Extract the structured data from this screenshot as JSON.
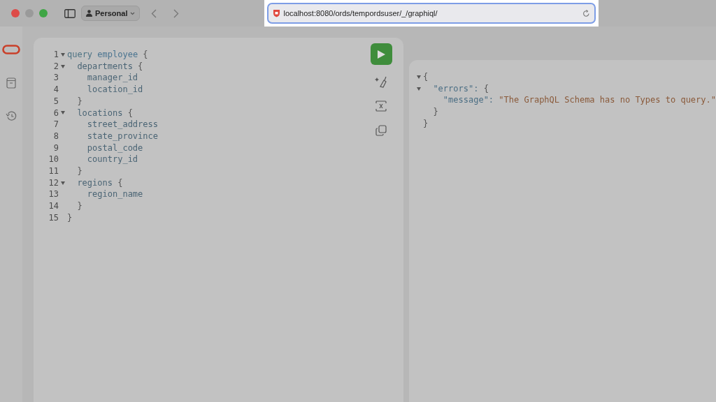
{
  "browser": {
    "profile": "Personal",
    "url": "localhost:8080/ords/tempordsuser/_/graphiql/"
  },
  "sidebar": {
    "items": [
      {
        "kind": "logo"
      },
      {
        "kind": "docs"
      },
      {
        "kind": "history"
      }
    ]
  },
  "editor": {
    "lines": [
      {
        "number": "1",
        "foldable": true,
        "tokens": [
          {
            "kind": "keyword",
            "text": "query"
          },
          {
            "kind": "name",
            "text": "employee"
          },
          {
            "kind": "punct",
            "text": "{"
          }
        ],
        "children": [
          {
            "number": "2",
            "foldable": true,
            "tokens": [
              {
                "kind": "field",
                "text": "departments"
              },
              {
                "kind": "punct",
                "text": "{"
              }
            ],
            "children": [
              {
                "number": "3",
                "foldable": false,
                "tokens": [
                  {
                    "kind": "field",
                    "text": "manager_id"
                  }
                ]
              },
              {
                "number": "4",
                "foldable": false,
                "tokens": [
                  {
                    "kind": "field",
                    "text": "location_id"
                  }
                ]
              }
            ]
          },
          {
            "number": "5",
            "foldable": false,
            "tokens": [
              {
                "kind": "punct",
                "text": "}"
              }
            ]
          },
          {
            "number": "6",
            "foldable": true,
            "tokens": [
              {
                "kind": "field",
                "text": "locations"
              },
              {
                "kind": "punct",
                "text": "{"
              }
            ],
            "children": [
              {
                "number": "7",
                "foldable": false,
                "tokens": [
                  {
                    "kind": "field",
                    "text": "street_address"
                  }
                ]
              },
              {
                "number": "8",
                "foldable": false,
                "tokens": [
                  {
                    "kind": "field",
                    "text": "state_province"
                  }
                ]
              },
              {
                "number": "9",
                "foldable": false,
                "tokens": [
                  {
                    "kind": "field",
                    "text": "postal_code"
                  }
                ]
              },
              {
                "number": "10",
                "foldable": false,
                "tokens": [
                  {
                    "kind": "field",
                    "text": "country_id"
                  }
                ]
              }
            ]
          },
          {
            "number": "11",
            "foldable": false,
            "tokens": [
              {
                "kind": "punct",
                "text": "}"
              }
            ]
          },
          {
            "number": "12",
            "foldable": true,
            "tokens": [
              {
                "kind": "field",
                "text": "regions"
              },
              {
                "kind": "punct",
                "text": "{"
              }
            ],
            "children": [
              {
                "number": "13",
                "foldable": false,
                "tokens": [
                  {
                    "kind": "field",
                    "text": "region_name"
                  }
                ]
              }
            ]
          },
          {
            "number": "14",
            "foldable": false,
            "tokens": [
              {
                "kind": "punct",
                "text": "}"
              }
            ]
          }
        ]
      },
      {
        "number": "15",
        "foldable": false,
        "tokens": [
          {
            "kind": "punct",
            "text": "}"
          }
        ]
      }
    ],
    "toolbar": [
      {
        "kind": "run"
      },
      {
        "kind": "prettify"
      },
      {
        "kind": "merge"
      },
      {
        "kind": "copy"
      }
    ]
  },
  "result": {
    "lines": [
      {
        "foldable": true,
        "tokens": [
          {
            "kind": "punct",
            "text": "{"
          }
        ],
        "children": [
          {
            "foldable": true,
            "tokens": [
              {
                "kind": "key",
                "text": "\"errors\":"
              },
              {
                "kind": "punct",
                "text": "{"
              }
            ],
            "children": [
              {
                "foldable": false,
                "tokens": [
                  {
                    "kind": "key",
                    "text": "\"message\":"
                  },
                  {
                    "kind": "string",
                    "text": "\"The GraphQL Schema has no Types to query.\""
                  }
                ]
              }
            ]
          },
          {
            "foldable": false,
            "tokens": [
              {
                "kind": "punct",
                "text": "}"
              }
            ]
          }
        ]
      },
      {
        "foldable": false,
        "tokens": [
          {
            "kind": "punct",
            "text": "}"
          }
        ]
      }
    ]
  }
}
